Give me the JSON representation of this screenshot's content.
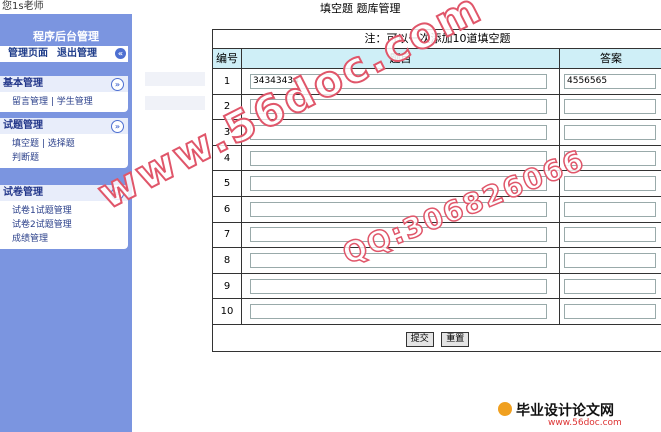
{
  "sidebar": {
    "user": "您1s老师",
    "title": "程序后台管理",
    "top_links": [
      "管理页面",
      "退出管理"
    ],
    "sections": [
      {
        "title": "基本管理",
        "items": [
          "留言管理",
          "学生管理"
        ]
      },
      {
        "title": "试题管理",
        "items": [
          "填空题",
          "选择题",
          "判断题"
        ]
      },
      {
        "title": "试卷管理",
        "items": [
          "试卷1试题管理",
          "试卷2试题管理",
          "成绩管理"
        ]
      }
    ]
  },
  "page_title": "填空题 题库管理",
  "form": {
    "note": "注：可以一次添加10道填空题",
    "headers": {
      "num": "编号",
      "question": "题目",
      "answer": "答案"
    },
    "rows": [
      {
        "num": "1",
        "question": "34343434",
        "answer": "4556565"
      },
      {
        "num": "2",
        "question": "",
        "answer": ""
      },
      {
        "num": "3",
        "question": "",
        "answer": ""
      },
      {
        "num": "4",
        "question": "",
        "answer": ""
      },
      {
        "num": "5",
        "question": "",
        "answer": ""
      },
      {
        "num": "6",
        "question": "",
        "answer": ""
      },
      {
        "num": "7",
        "question": "",
        "answer": ""
      },
      {
        "num": "8",
        "question": "",
        "answer": ""
      },
      {
        "num": "9",
        "question": "",
        "answer": ""
      },
      {
        "num": "10",
        "question": "",
        "answer": ""
      }
    ],
    "submit_label": "提交",
    "reset_label": "重置"
  },
  "watermark": {
    "url": "www.56doc.com",
    "qq": "QQ:306826066"
  },
  "logo": {
    "text": "毕业设计论文网",
    "url": "www.56doc.com"
  },
  "colors": {
    "sidebar": "#7b95e0",
    "table_header": "#cfeff7",
    "watermark": "#e0566a"
  }
}
